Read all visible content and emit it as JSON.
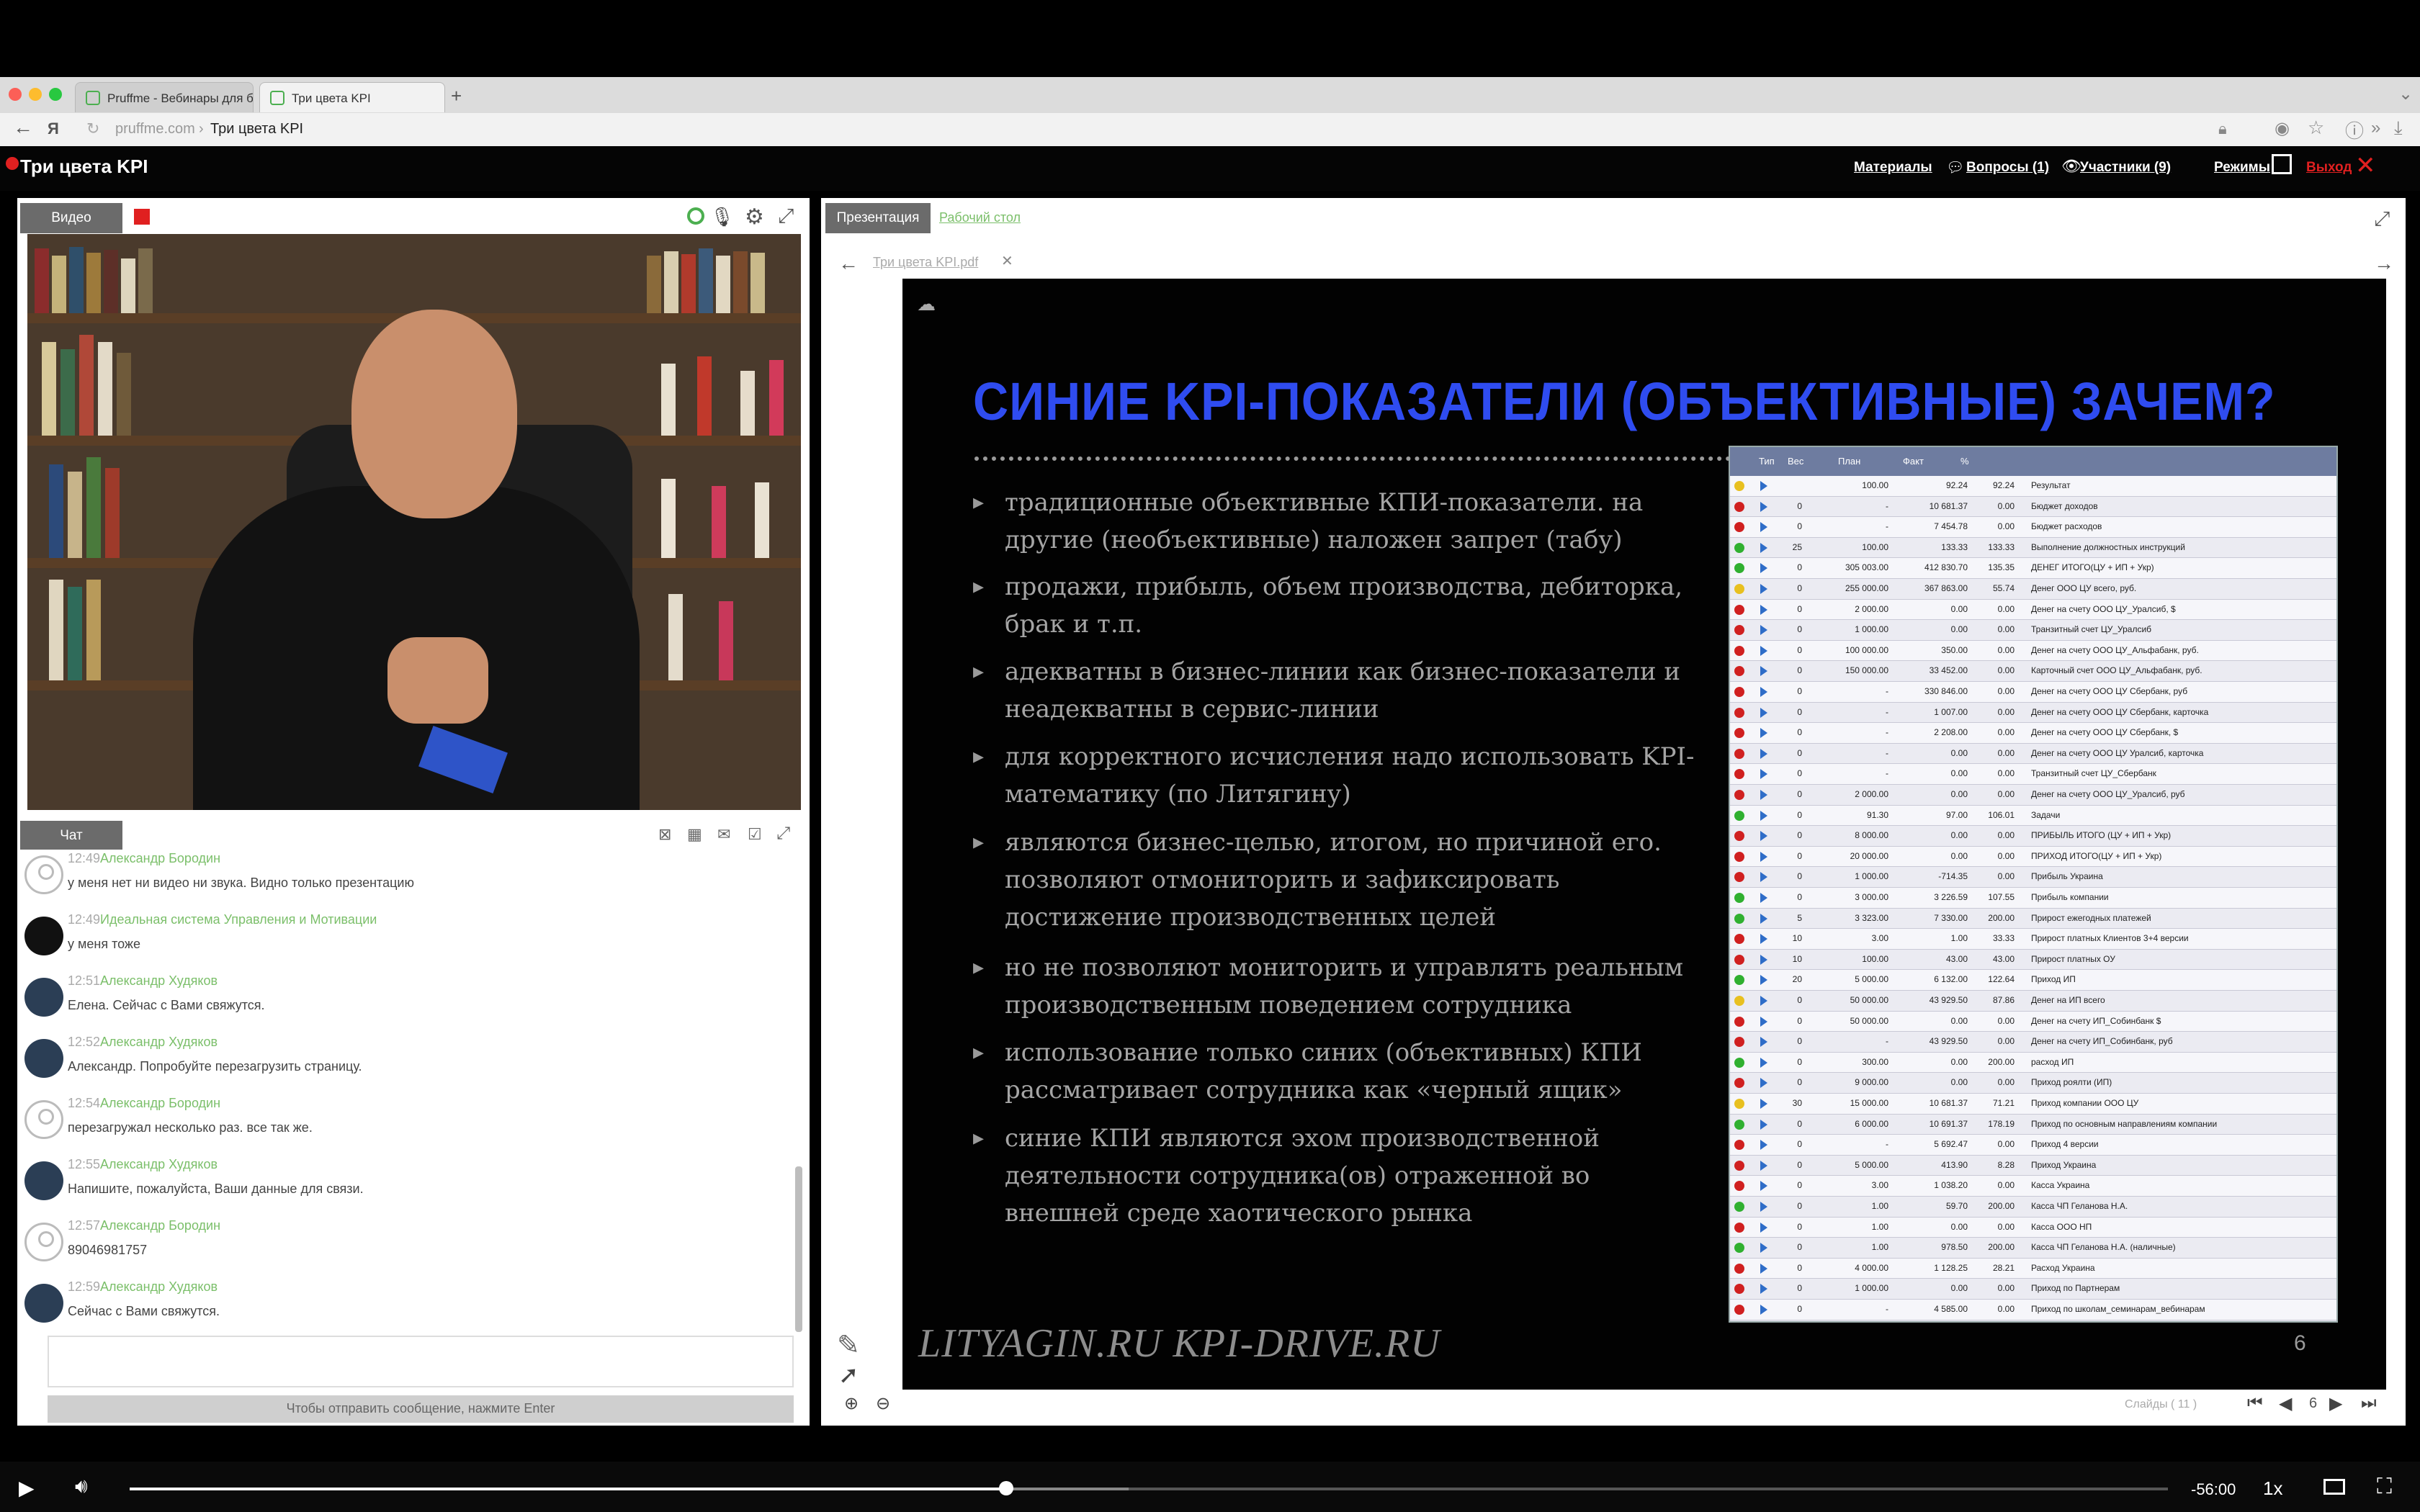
{
  "browser": {
    "tabs": [
      {
        "label": "Pruffme - Вебинары для б..."
      },
      {
        "label": "Три цвета KPI"
      }
    ],
    "url": "pruffme.com",
    "page_title": "Три цвета KPI"
  },
  "app": {
    "title": "Три цвета KPI",
    "menu": {
      "materials": "Материалы",
      "questions": "Вопросы (1)",
      "participants": "Участники (9)",
      "modes": "Режимы",
      "exit": "Выход"
    }
  },
  "video_panel": {
    "tab": "Видео"
  },
  "chat": {
    "tab": "Чат",
    "messages": [
      {
        "time": "12:49",
        "author": "Александр Бородин",
        "text": "у меня нет ни видео ни звука. Видно только презентацию",
        "avatar": "generic"
      },
      {
        "time": "12:49",
        "author": "Идеальная система Управления и Мотивации",
        "text": "у меня тоже",
        "avatar": "logo"
      },
      {
        "time": "12:51",
        "author": "Александр Худяков",
        "text": "Елена. Сейчас с Вами свяжутся.",
        "avatar": "photo"
      },
      {
        "time": "12:52",
        "author": "Александр Худяков",
        "text": "Александр. Попробуйте перезагрузить страницу.",
        "avatar": "photo"
      },
      {
        "time": "12:54",
        "author": "Александр Бородин",
        "text": "перезагружал несколько раз. все так же.",
        "avatar": "generic"
      },
      {
        "time": "12:55",
        "author": "Александр Худяков",
        "text": "Напишите, пожалуйста, Ваши данные для связи.",
        "avatar": "photo"
      },
      {
        "time": "12:57",
        "author": "Александр Бородин",
        "text": "89046981757",
        "avatar": "generic"
      },
      {
        "time": "12:59",
        "author": "Александр Худяков",
        "text": "Сейчас с Вами свяжутся.",
        "avatar": "photo"
      }
    ],
    "send_hint": "Чтобы отправить сообщение, нажмите Enter"
  },
  "presentation": {
    "tabs": {
      "active": "Презентация",
      "other": "Рабочий стол"
    },
    "file_tab": "Три цвета KPI.pdf",
    "slide": {
      "title": "СИНИЕ KPI-ПОКАЗАТЕЛИ (ОБЪЕКТИВНЫЕ) ЗАЧЕМ?",
      "bullets": [
        "традиционные объективные КПИ-показатели. на другие (необъективные) наложен запрет (табу)",
        "продажи, прибыль, объем производства, дебиторка, брак и т.п.",
        "адекватны в бизнес-линии как бизнес-показатели и неадекватны в сервис-линии",
        "для корректного исчисления надо использовать KPI-математику (по Литягину)",
        "являются бизнес-целью, итогом, но причиной его. позволяют отмониторить и зафиксировать достижение производственных целей",
        "но не позволяют мониторить и управлять реальным производственным поведением сотрудника",
        "использование только синих (объективных) КПИ рассматривает сотрудника как «черный ящик»",
        "синие КПИ являются эхом производственной деятельности сотрудника(ов) отраженной во внешней среде хаотического рынка"
      ],
      "footer": "LITYAGIN.RU  KPI-DRIVE.RU",
      "page_number": "6"
    },
    "kpi_table": {
      "headers": [
        "Тип",
        "Вес",
        "План",
        "Факт",
        "%"
      ],
      "rows": [
        {
          "status": "#e8c020",
          "w": "",
          "plan": "100.00",
          "fact": "92.24",
          "pct": "92.24",
          "name": "Результат"
        },
        {
          "status": "#d02020",
          "w": "0",
          "plan": "-",
          "fact": "10 681.37",
          "pct": "0.00",
          "name": "Бюджет доходов"
        },
        {
          "status": "#d02020",
          "w": "0",
          "plan": "-",
          "fact": "7 454.78",
          "pct": "0.00",
          "name": "Бюджет расходов"
        },
        {
          "status": "#30b030",
          "w": "25",
          "plan": "100.00",
          "fact": "133.33",
          "pct": "133.33",
          "name": "Выполнение должностных инструкций"
        },
        {
          "status": "#30b030",
          "w": "0",
          "plan": "305 003.00",
          "fact": "412 830.70",
          "pct": "135.35",
          "name": "ДЕНЕГ ИТОГО(ЦУ + ИП + Укр)"
        },
        {
          "status": "#e8c020",
          "w": "0",
          "plan": "255 000.00",
          "fact": "367 863.00",
          "pct": "55.74",
          "name": "Денег ООО ЦУ всего, руб."
        },
        {
          "status": "#d02020",
          "w": "0",
          "plan": "2 000.00",
          "fact": "0.00",
          "pct": "0.00",
          "name": "Денег на счету ООО ЦУ_Уралсиб, $"
        },
        {
          "status": "#d02020",
          "w": "0",
          "plan": "1 000.00",
          "fact": "0.00",
          "pct": "0.00",
          "name": "Транзитный счет ЦУ_Уралсиб"
        },
        {
          "status": "#d02020",
          "w": "0",
          "plan": "100 000.00",
          "fact": "350.00",
          "pct": "0.00",
          "name": "Денег на счету ООО ЦУ_Альфабанк, руб."
        },
        {
          "status": "#d02020",
          "w": "0",
          "plan": "150 000.00",
          "fact": "33 452.00",
          "pct": "0.00",
          "name": "Карточный счет ООО ЦУ_Альфабанк, руб."
        },
        {
          "status": "#d02020",
          "w": "0",
          "plan": "-",
          "fact": "330 846.00",
          "pct": "0.00",
          "name": "Денег на счету ООО ЦУ Сбербанк, руб"
        },
        {
          "status": "#d02020",
          "w": "0",
          "plan": "-",
          "fact": "1 007.00",
          "pct": "0.00",
          "name": "Денег на счету ООО ЦУ Сбербанк, карточка"
        },
        {
          "status": "#d02020",
          "w": "0",
          "plan": "-",
          "fact": "2 208.00",
          "pct": "0.00",
          "name": "Денег на счету ООО ЦУ Сбербанк, $"
        },
        {
          "status": "#d02020",
          "w": "0",
          "plan": "-",
          "fact": "0.00",
          "pct": "0.00",
          "name": "Денег на счету ООО ЦУ Уралсиб, карточка"
        },
        {
          "status": "#d02020",
          "w": "0",
          "plan": "-",
          "fact": "0.00",
          "pct": "0.00",
          "name": "Транзитный счет ЦУ_Сбербанк"
        },
        {
          "status": "#d02020",
          "w": "0",
          "plan": "2 000.00",
          "fact": "0.00",
          "pct": "0.00",
          "name": "Денег на счету ООО ЦУ_Уралсиб, руб"
        },
        {
          "status": "#30b030",
          "w": "0",
          "plan": "91.30",
          "fact": "97.00",
          "pct": "106.01",
          "name": "Задачи"
        },
        {
          "status": "#d02020",
          "w": "0",
          "plan": "8 000.00",
          "fact": "0.00",
          "pct": "0.00",
          "name": "ПРИБЫЛЬ ИТОГО (ЦУ + ИП + Укр)"
        },
        {
          "status": "#d02020",
          "w": "0",
          "plan": "20 000.00",
          "fact": "0.00",
          "pct": "0.00",
          "name": "ПРИХОД ИТОГО(ЦУ + ИП + Укр)"
        },
        {
          "status": "#d02020",
          "w": "0",
          "plan": "1 000.00",
          "fact": "-714.35",
          "pct": "0.00",
          "name": "Прибыль Украина"
        },
        {
          "status": "#30b030",
          "w": "0",
          "plan": "3 000.00",
          "fact": "3 226.59",
          "pct": "107.55",
          "name": "Прибыль компании"
        },
        {
          "status": "#30b030",
          "w": "5",
          "plan": "3 323.00",
          "fact": "7 330.00",
          "pct": "200.00",
          "name": "Прирост ежегодных платежей"
        },
        {
          "status": "#d02020",
          "w": "10",
          "plan": "3.00",
          "fact": "1.00",
          "pct": "33.33",
          "name": "Прирост платных Клиентов 3+4 версии"
        },
        {
          "status": "#d02020",
          "w": "10",
          "plan": "100.00",
          "fact": "43.00",
          "pct": "43.00",
          "name": "Прирост платных ОУ"
        },
        {
          "status": "#30b030",
          "w": "20",
          "plan": "5 000.00",
          "fact": "6 132.00",
          "pct": "122.64",
          "name": "Приход ИП"
        },
        {
          "status": "#e8c020",
          "w": "0",
          "plan": "50 000.00",
          "fact": "43 929.50",
          "pct": "87.86",
          "name": "Денег на ИП всего"
        },
        {
          "status": "#d02020",
          "w": "0",
          "plan": "50 000.00",
          "fact": "0.00",
          "pct": "0.00",
          "name": "Денег на счету ИП_Собинбанк $"
        },
        {
          "status": "#d02020",
          "w": "0",
          "plan": "-",
          "fact": "43 929.50",
          "pct": "0.00",
          "name": "Денег на счету ИП_Собинбанк, руб"
        },
        {
          "status": "#30b030",
          "w": "0",
          "plan": "300.00",
          "fact": "0.00",
          "pct": "200.00",
          "name": "расход ИП"
        },
        {
          "status": "#d02020",
          "w": "0",
          "plan": "9 000.00",
          "fact": "0.00",
          "pct": "0.00",
          "name": "Приход роялти (ИП)"
        },
        {
          "status": "#e8c020",
          "w": "30",
          "plan": "15 000.00",
          "fact": "10 681.37",
          "pct": "71.21",
          "name": "Приход компании ООО ЦУ"
        },
        {
          "status": "#30b030",
          "w": "0",
          "plan": "6 000.00",
          "fact": "10 691.37",
          "pct": "178.19",
          "name": "Приход по основным направлениям компании"
        },
        {
          "status": "#d02020",
          "w": "0",
          "plan": "-",
          "fact": "5 692.47",
          "pct": "0.00",
          "name": "Приход 4 версии"
        },
        {
          "status": "#d02020",
          "w": "0",
          "plan": "5 000.00",
          "fact": "413.90",
          "pct": "8.28",
          "name": "Приход Украина"
        },
        {
          "status": "#d02020",
          "w": "0",
          "plan": "3.00",
          "fact": "1 038.20",
          "pct": "0.00",
          "name": "Касса Украина"
        },
        {
          "status": "#30b030",
          "w": "0",
          "plan": "1.00",
          "fact": "59.70",
          "pct": "200.00",
          "name": "Касса ЧП Геланова Н.А."
        },
        {
          "status": "#d02020",
          "w": "0",
          "plan": "1.00",
          "fact": "0.00",
          "pct": "0.00",
          "name": "Касса ООО НП"
        },
        {
          "status": "#30b030",
          "w": "0",
          "plan": "1.00",
          "fact": "978.50",
          "pct": "200.00",
          "name": "Касса ЧП Геланова Н.А. (наличные)"
        },
        {
          "status": "#d02020",
          "w": "0",
          "plan": "4 000.00",
          "fact": "1 128.25",
          "pct": "28.21",
          "name": "Расход Украина"
        },
        {
          "status": "#d02020",
          "w": "0",
          "plan": "1 000.00",
          "fact": "0.00",
          "pct": "0.00",
          "name": "Приход по Партнерам"
        },
        {
          "status": "#d02020",
          "w": "0",
          "plan": "-",
          "fact": "4 585.00",
          "pct": "0.00",
          "name": "Приход по школам_семинарам_вебинарам"
        }
      ]
    },
    "pager": {
      "label": "Слайды ( 11 )",
      "current": "6"
    }
  },
  "player": {
    "time_remaining": "-56:00",
    "speed": "1x",
    "progress": 0.43,
    "buffered": 0.49
  }
}
